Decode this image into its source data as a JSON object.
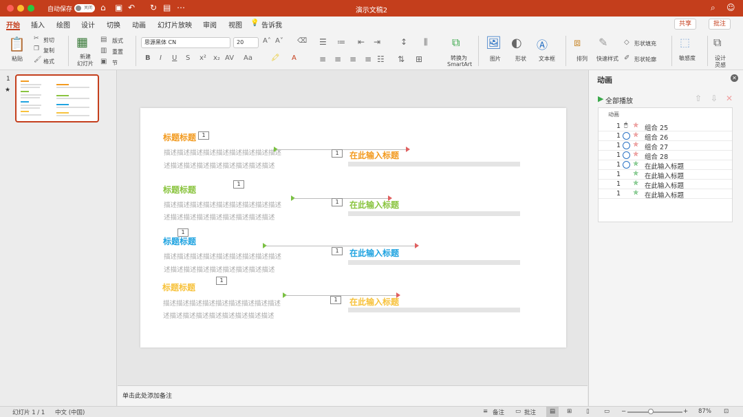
{
  "window": {
    "title": "演示文稿2",
    "autosave_label": "自动保存",
    "autosave_state": "关闭"
  },
  "tabs": [
    "开始",
    "插入",
    "绘图",
    "设计",
    "切换",
    "动画",
    "幻灯片放映",
    "审阅",
    "视图"
  ],
  "tell_me": "告诉我",
  "share_label": "共享",
  "comments_label": "批注",
  "ribbon": {
    "paste": "粘贴",
    "cut": "剪切",
    "copy": "复制",
    "format": "格式",
    "new_slide_l1": "新建",
    "new_slide_l2": "幻灯片",
    "layout": "版式",
    "reset": "重置",
    "section": "节",
    "font_name": "思源黑体 CN",
    "font_size": "20",
    "convert_l1": "转换为",
    "convert_l2": "SmartArt",
    "picture": "图片",
    "shape": "形状",
    "textbox": "文本框",
    "arrange": "排列",
    "quick_styles": "快速样式",
    "shape_fill": "形状填充",
    "shape_outline": "形状轮廓",
    "sensitivity": "敏感度",
    "designer_l1": "设计",
    "designer_l2": "灵感"
  },
  "thumbnail": {
    "number": "1",
    "star": "★"
  },
  "slide": {
    "sections": [
      {
        "heading": "标题标题",
        "color": "#f29a1f",
        "desc1": "描述描述描述描述描述描述描述描述描述",
        "desc2": "述描述描述描述描述描述描述描述描述",
        "placeholder": "在此输入标题",
        "badge_a": "1",
        "badge_b": "1"
      },
      {
        "heading": "标题标题",
        "color": "#8ac43f",
        "desc1": "描述描述描述描述描述描述描述描述描述",
        "desc2": "述描述描述描述描述描述描述描述描述",
        "placeholder": "在此输入标题",
        "badge_a": "1",
        "badge_b": "1"
      },
      {
        "heading": "标题标题",
        "color": "#1fa3e0",
        "desc1": "描述描述描述描述描述描述描述描述描述",
        "desc2": "述描述描述描述描述描述描述描述描述",
        "placeholder": "在此输入标题",
        "badge_a": "1",
        "badge_b": "1"
      },
      {
        "heading": "标题标题",
        "color": "#f7c23c",
        "desc1": "描述描述描述描述描述描述描述描述描述",
        "desc2": "述描述描述描述描述描述描述描述描述",
        "placeholder": "在此输入标题",
        "badge_a": "1",
        "badge_b": "1"
      }
    ]
  },
  "notes_placeholder": "单击此处添加备注",
  "animation_pane": {
    "title": "动画",
    "play_all": "全部播放",
    "list_header": "动画",
    "items": [
      {
        "index": "1",
        "name": "组合 25",
        "trigger": "on-click"
      },
      {
        "index": "1",
        "name": "组合 26",
        "trigger": "after-previous"
      },
      {
        "index": "1",
        "name": "组合 27",
        "trigger": "after-previous"
      },
      {
        "index": "1",
        "name": "组合 28",
        "trigger": "after-previous"
      },
      {
        "index": "1",
        "name": "在此输入标题",
        "trigger": "after-previous"
      },
      {
        "index": "1",
        "name": "在此输入标题",
        "trigger": "with-previous"
      },
      {
        "index": "1",
        "name": "在此输入标题",
        "trigger": "with-previous"
      },
      {
        "index": "1",
        "name": "在此输入标题",
        "trigger": "with-previous"
      }
    ]
  },
  "status": {
    "slide_info": "幻灯片 1 / 1",
    "language": "中文 (中国)",
    "notes": "备注",
    "comments": "批注",
    "zoom": "87%"
  }
}
